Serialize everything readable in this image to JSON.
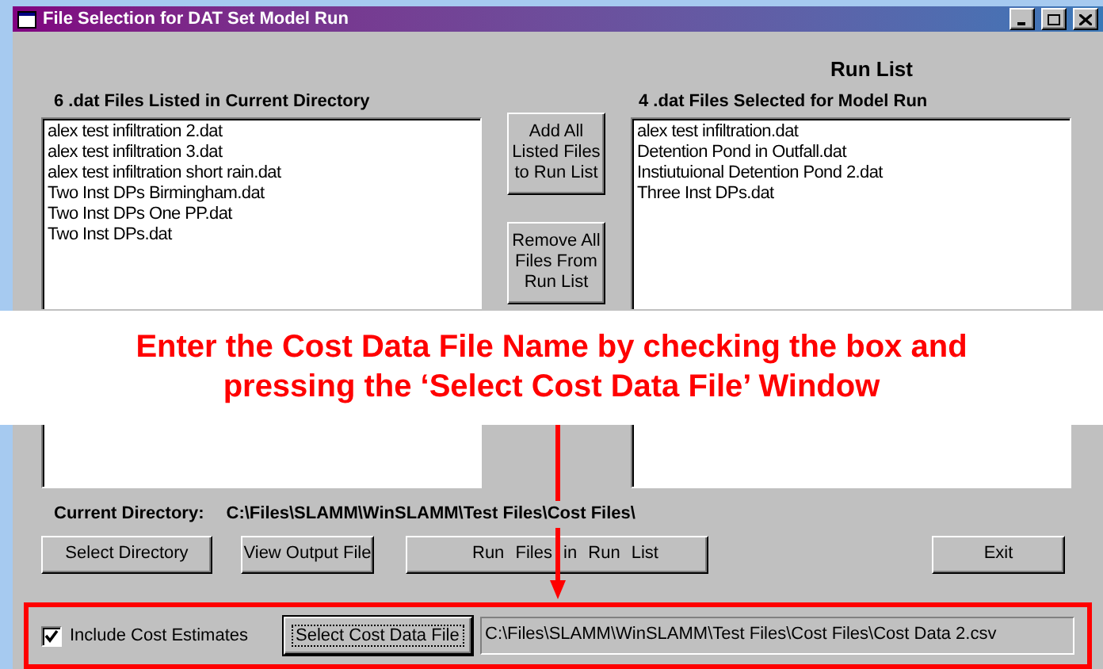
{
  "window": {
    "title": "File Selection for DAT Set Model Run"
  },
  "run_list_heading": "Run List",
  "available_files": {
    "label": "6 .dat Files Listed in Current Directory",
    "items": [
      "alex test infiltration 2.dat",
      "alex test infiltration 3.dat",
      "alex test infiltration short rain.dat",
      "Two Inst DPs Birmingham.dat",
      "Two Inst DPs One PP.dat",
      "Two Inst DPs.dat"
    ]
  },
  "transfer_buttons": [
    "Add All Listed Files to Run List",
    "Remove All Files From Run List"
  ],
  "selected_files": {
    "label": "4 .dat Files Selected for Model Run",
    "items": [
      "alex test infiltration.dat",
      "Detention Pond in Outfall.dat",
      "Instiutuional Detention Pond 2.dat",
      "Three Inst DPs.dat"
    ]
  },
  "current_directory": {
    "label": "Current Directory:",
    "value": "C:\\Files\\SLAMM\\WinSLAMM\\Test Files\\Cost Files\\"
  },
  "action_buttons": [
    "Select Directory",
    "View Output File",
    "Run Files in Run List",
    "Exit"
  ],
  "cost": {
    "checkbox_label": "Include Cost Estimates",
    "checked": true,
    "button": "Select Cost Data File",
    "path": "C:\\Files\\SLAMM\\WinSLAMM\\Test Files\\Cost Files\\Cost Data 2.csv"
  },
  "annotation": [
    "Enter the Cost Data File Name by checking the box and",
    "pressing the ‘Select Cost Data File’ Window"
  ]
}
